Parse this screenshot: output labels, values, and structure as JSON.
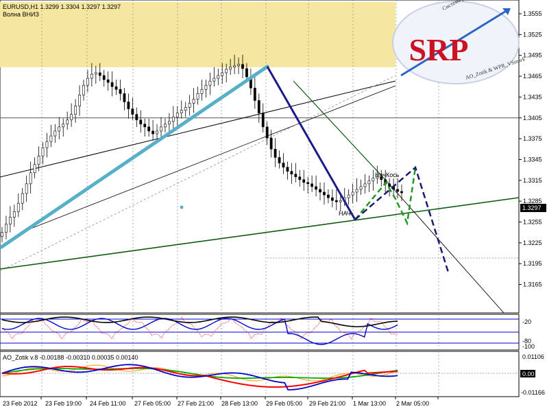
{
  "chart_data": {
    "type": "candlestick",
    "symbol_header": "EURUSD,H1  1.3299 1.3304 1.3297 1.3297",
    "subtitle": "Волна ВНИЗ",
    "price_ticks": [
      "1.3555",
      "1.3525",
      "1.3495",
      "1.3465",
      "1.3435",
      "1.3405",
      "1.3375",
      "1.3345",
      "1.3315",
      "1.3285",
      "1.3255",
      "1.3225",
      "1.3195",
      "1.3165"
    ],
    "current_price_label": "1.3297",
    "time_ticks": [
      "23 Feb 2012",
      "23 Feb 19:00",
      "24 Feb 11:00",
      "27 Feb 05:00",
      "27 Feb 21:00",
      "28 Feb 13:00",
      "29 Feb 05:00",
      "29 Feb 21:00",
      "1 Mar 13:00",
      "2 Mar 05:00"
    ],
    "annotations": [
      "НАЧ",
      "НачКось"
    ],
    "candles_close": [
      1.324,
      1.3252,
      1.3262,
      1.327,
      1.3282,
      1.3296,
      1.331,
      1.3326,
      1.3338,
      1.335,
      1.3362,
      1.3371,
      1.3379,
      1.3386,
      1.3392,
      1.3396,
      1.3402,
      1.341,
      1.3422,
      1.3438,
      1.3452,
      1.3462,
      1.3468,
      1.347,
      1.3466,
      1.346,
      1.3456,
      1.345,
      1.3446,
      1.344,
      1.3428,
      1.3418,
      1.341,
      1.3402,
      1.3396,
      1.3392,
      1.3386,
      1.3382,
      1.3386,
      1.3392,
      1.3396,
      1.34,
      1.3406,
      1.3412,
      1.3416,
      1.342,
      1.3426,
      1.3432,
      1.344,
      1.3446,
      1.3452,
      1.3458,
      1.3462,
      1.3466,
      1.347,
      1.3475,
      1.3478,
      1.348,
      1.3482,
      1.3476,
      1.3464,
      1.3448,
      1.343,
      1.3412,
      1.3392,
      1.3376,
      1.336,
      1.3348,
      1.334,
      1.3334,
      1.3328,
      1.3324,
      1.332,
      1.3316,
      1.3312,
      1.331,
      1.3306,
      1.3302,
      1.3298,
      1.3294,
      1.329,
      1.3286,
      1.3284,
      1.3286,
      1.329,
      1.3294,
      1.3298,
      1.3302,
      1.3306,
      1.331,
      1.3314,
      1.3318,
      1.332,
      1.3316,
      1.331,
      1.3306,
      1.3302,
      1.3299,
      1.3297
    ],
    "ind1_levels": [
      "-20",
      "-80",
      "-100"
    ],
    "ind2_label": "AO_Zotik v.8 -0.00188 -0.00310 0.00035 0.00140",
    "ind2_ticks": [
      "0.01106",
      "0.00",
      "-0.01166"
    ],
    "logo_text": "SRP",
    "logo_top_text": "Система раннего прогнозирования",
    "logo_bottom_text": "AO_Zotik & WPR_VSmark",
    "colors": {
      "up_candle": "#ffffff",
      "down_candle": "#000000",
      "trend_up": "#56b0c8",
      "trend_down": "#1a1a8a",
      "forecast_green": "#1f9a1f",
      "forecast_blue": "#1a1a6e",
      "channel_green": "#0e5a0e",
      "yellow_zone": "#f5e6a0",
      "ind_black": "#000000",
      "ind_blue": "#0000cc",
      "ind_red": "#ff0000",
      "ind_green": "#00aa00",
      "ind_orange": "#ff9900",
      "logo_red": "#cc1122"
    }
  }
}
